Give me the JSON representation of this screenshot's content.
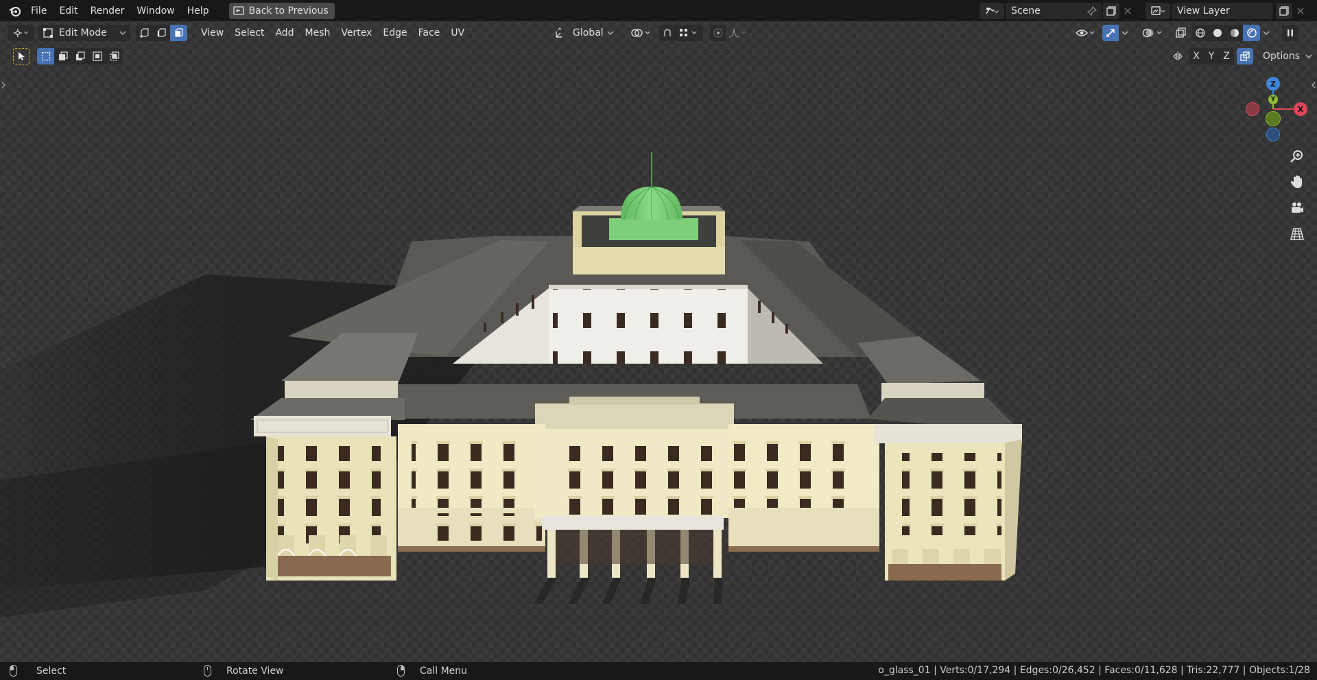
{
  "topbar": {
    "menus": [
      "File",
      "Edit",
      "Render",
      "Window",
      "Help"
    ],
    "back_button": "Back to Previous",
    "scene": "Scene",
    "view_layer": "View Layer"
  },
  "header": {
    "mode": "Edit Mode",
    "menus": [
      "View",
      "Select",
      "Add",
      "Mesh",
      "Vertex",
      "Edge",
      "Face",
      "UV"
    ],
    "transform_orientation": "Global",
    "options_label": "Options",
    "axis_x": "X",
    "axis_y": "Y",
    "axis_z": "Z"
  },
  "gizmo": {
    "x": "X",
    "y": "Y",
    "z": "Z"
  },
  "statusbar": {
    "select": "Select",
    "rotate": "Rotate View",
    "call_menu": "Call Menu",
    "stats": "o_glass_01 | Verts:0/17,294 | Edges:0/26,452 | Faces:0/11,628 | Tris:22,777 | Objects:1/28"
  },
  "colors": {
    "accent": "#4772b3",
    "dome": "#7ed07a",
    "facade": "#ece6bd",
    "roof": "#5e5d58",
    "axis_x": "#e0455a",
    "axis_y": "#8cbd2c",
    "axis_z": "#3d86d9"
  }
}
